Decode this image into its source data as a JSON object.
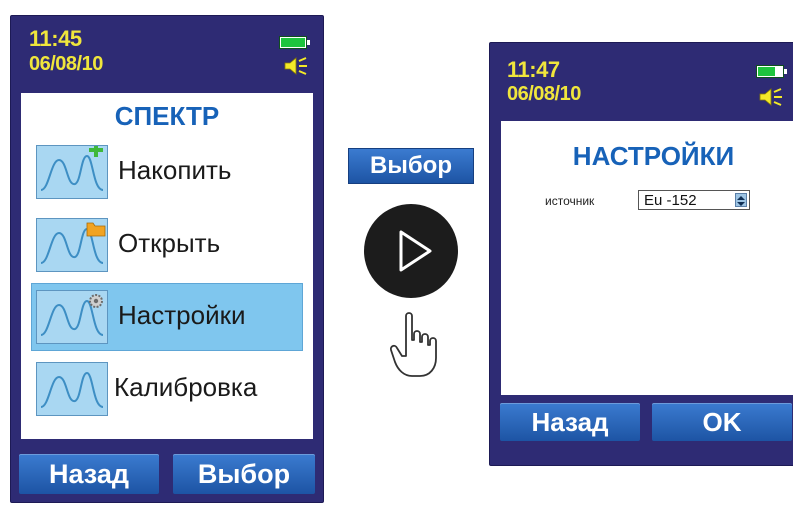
{
  "left_device": {
    "time": "11:45",
    "date": "06/08/10",
    "battery_level": 1.0,
    "screen_title": "СПЕКТР",
    "menu": [
      {
        "label": "Накопить",
        "icon": "spectrum-add-icon",
        "selected": false
      },
      {
        "label": "Открыть",
        "icon": "spectrum-folder-icon",
        "selected": false
      },
      {
        "label": "Настройки",
        "icon": "spectrum-gear-icon",
        "selected": true
      },
      {
        "label": "Калибровка",
        "icon": "spectrum-icon",
        "selected": false
      }
    ],
    "left_softkey": "Назад",
    "right_softkey": "Выбор"
  },
  "transition": {
    "button_label": "Выбор",
    "icons": [
      "play-icon",
      "pointing-hand-icon"
    ]
  },
  "right_device": {
    "time": "11:47",
    "date": "06/08/10",
    "battery_level": 0.7,
    "screen_title": "НАСТРОЙКИ",
    "setting_label": "источник",
    "setting_value": "Eu -152",
    "left_softkey": "Назад",
    "right_softkey": "OK"
  },
  "colors": {
    "device_body": "#2e2b74",
    "status_text": "#f0e63c",
    "title_blue": "#1762b8",
    "selected_item": "#7fc6ee",
    "softkey_blue": "#2b64b4"
  }
}
